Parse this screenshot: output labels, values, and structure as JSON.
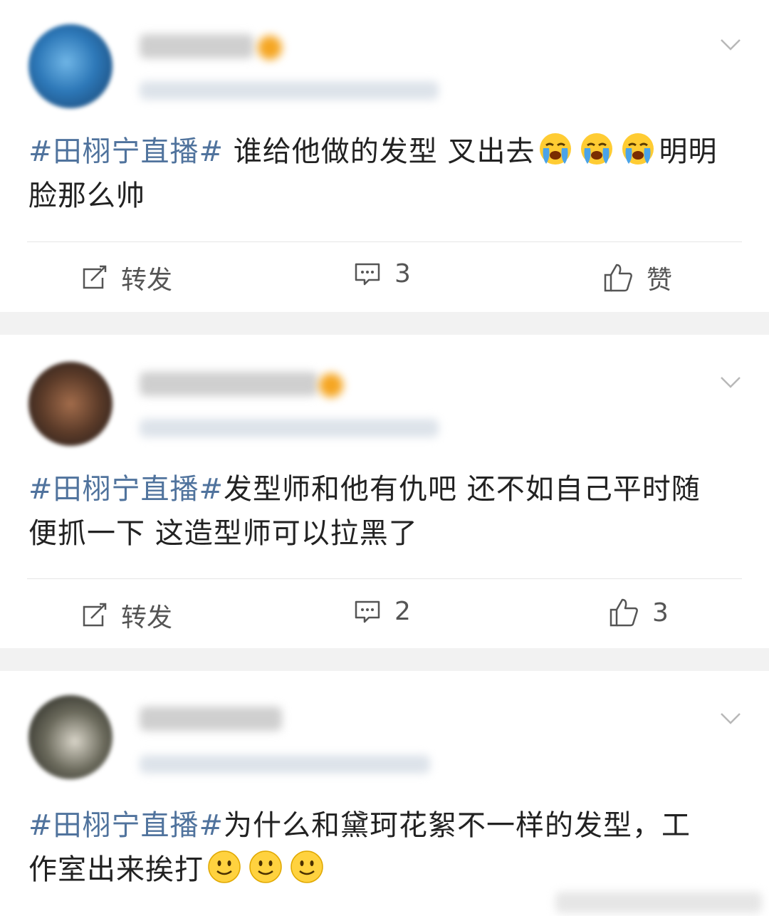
{
  "posts": [
    {
      "topic": "#田栩宁直播#",
      "text_lines": [
        " 谁给他做的发型 叉出去",
        "明明脸那么帅"
      ],
      "emoji": [
        "crying-face",
        "crying-face",
        "crying-face"
      ],
      "actions": {
        "repost": "转发",
        "comments": "3",
        "like": "赞"
      }
    },
    {
      "topic": "#田栩宁直播#",
      "text_lines": [
        "发型师和他有仇吧 还不如自己平时随",
        "便抓一下  这造型师可以拉黑了"
      ],
      "actions": {
        "repost": "转发",
        "comments": "2",
        "like": "3"
      }
    },
    {
      "topic": "#田栩宁直播#",
      "text_lines": [
        "为什么和黛珂花絮不一样的发型，工",
        "作室出来挨打"
      ],
      "emoji": [
        "smile-face",
        "smile-face",
        "smile-face"
      ]
    }
  ],
  "colors": {
    "topic": "#50739d",
    "text": "#222222",
    "background": "#f2f2f2"
  }
}
